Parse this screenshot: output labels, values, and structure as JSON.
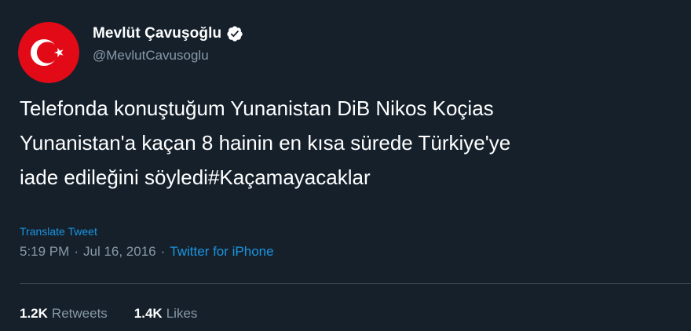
{
  "colors": {
    "background": "#15202b",
    "text": "#ffffff",
    "secondary_text": "#8899a6",
    "link": "#1b95e0",
    "avatar_red": "#e30a17",
    "verified_badge": "#ffffff"
  },
  "author": {
    "display_name": "Mevlüt Çavuşoğlu",
    "handle": "@MevlutCavusoglu",
    "verified": true,
    "verified_icon": "verified-badge-icon",
    "avatar_icon": "turkish-flag-avatar"
  },
  "tweet": {
    "text": "Telefonda konuştuğum Yunanistan DiB Nikos Koçias\nYunanistan'a kaçan 8 hainin en kısa sürede Türkiye'ye\niade edileğini söyledi#Kaçamayacaklar",
    "translate_label": "Translate Tweet",
    "time": "5:19 PM",
    "separator": "·",
    "date": "Jul 16, 2016",
    "source": "Twitter for iPhone"
  },
  "stats": {
    "retweets_count": "1.2K",
    "retweets_label": "Retweets",
    "likes_count": "1.4K",
    "likes_label": "Likes"
  }
}
